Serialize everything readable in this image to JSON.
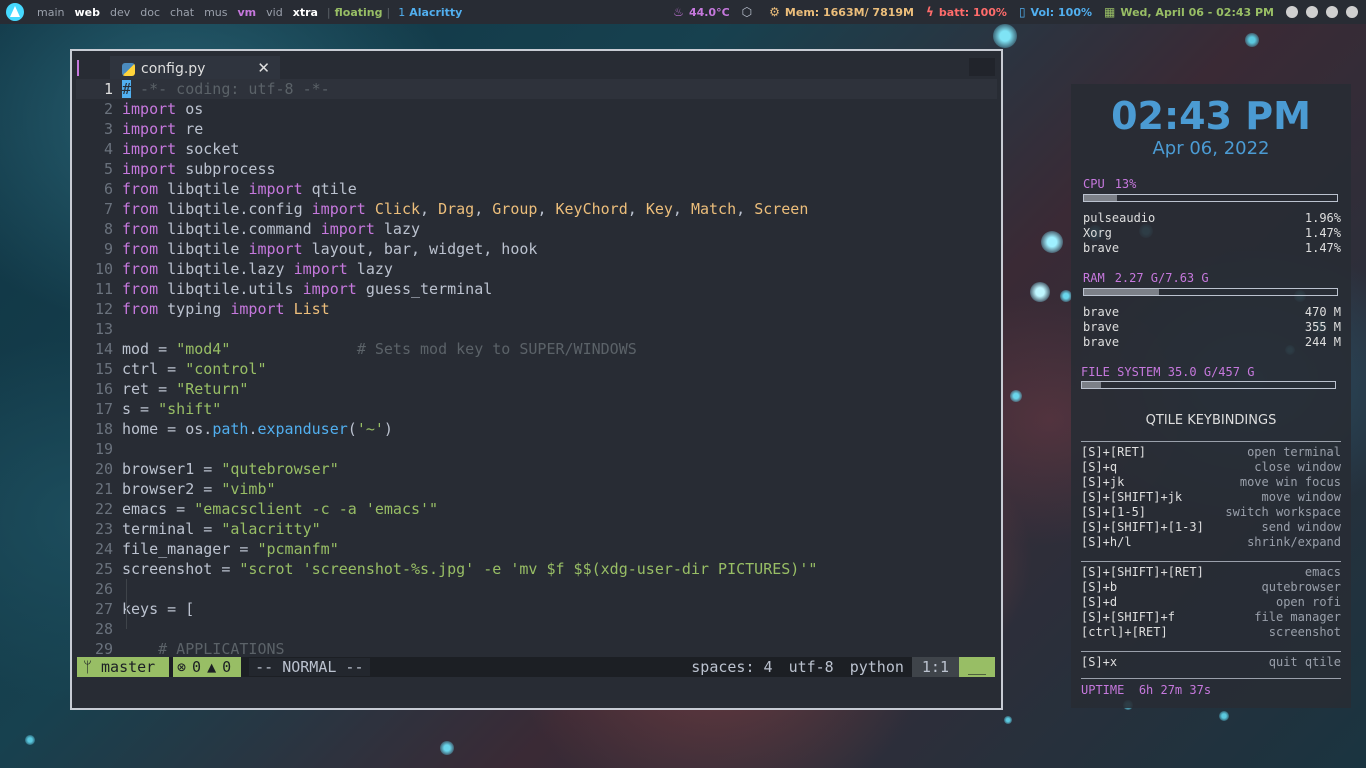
{
  "topbar": {
    "workspaces": [
      {
        "label": "main",
        "state": "normal"
      },
      {
        "label": "web",
        "state": "active"
      },
      {
        "label": "dev",
        "state": "normal"
      },
      {
        "label": "doc",
        "state": "normal"
      },
      {
        "label": "chat",
        "state": "normal"
      },
      {
        "label": "mus",
        "state": "normal"
      },
      {
        "label": "vm",
        "state": "current"
      },
      {
        "label": "vid",
        "state": "normal"
      },
      {
        "label": "xtra",
        "state": "active"
      }
    ],
    "layout": "floating",
    "window_count": "1",
    "window_title": "Alacritty",
    "temp": "44.0°C",
    "mem": "Mem: 1663M/ 7819M",
    "batt": "batt: 100%",
    "vol": "Vol: 100%",
    "date": "Wed, April 06 - 02:43 PM",
    "colors": {
      "accent": "#51afef",
      "purple": "#c678dd",
      "green": "#98be65",
      "yellow": "#ecbe7b",
      "red": "#ff6c6b"
    }
  },
  "editor": {
    "tab_name": "config.py",
    "close_glyph": "✕",
    "lines": [
      [
        {
          "t": "#",
          "c": "cursor"
        },
        {
          "t": " -*- coding: utf-8 -*-",
          "c": "cmt"
        }
      ],
      [
        {
          "t": "import",
          "c": "kw"
        },
        {
          "t": " os",
          "c": ""
        }
      ],
      [
        {
          "t": "import",
          "c": "kw"
        },
        {
          "t": " re",
          "c": ""
        }
      ],
      [
        {
          "t": "import",
          "c": "kw"
        },
        {
          "t": " socket",
          "c": ""
        }
      ],
      [
        {
          "t": "import",
          "c": "kw"
        },
        {
          "t": " subprocess",
          "c": ""
        }
      ],
      [
        {
          "t": "from",
          "c": "kw"
        },
        {
          "t": " libqtile ",
          "c": ""
        },
        {
          "t": "import",
          "c": "kw"
        },
        {
          "t": " qtile",
          "c": ""
        }
      ],
      [
        {
          "t": "from",
          "c": "kw"
        },
        {
          "t": " libqtile.config ",
          "c": ""
        },
        {
          "t": "import",
          "c": "kw"
        },
        {
          "t": " ",
          "c": ""
        },
        {
          "t": "Click",
          "c": "cls"
        },
        {
          "t": ", ",
          "c": ""
        },
        {
          "t": "Drag",
          "c": "cls"
        },
        {
          "t": ", ",
          "c": ""
        },
        {
          "t": "Group",
          "c": "cls"
        },
        {
          "t": ", ",
          "c": ""
        },
        {
          "t": "KeyChord",
          "c": "cls"
        },
        {
          "t": ", ",
          "c": ""
        },
        {
          "t": "Key",
          "c": "cls"
        },
        {
          "t": ", ",
          "c": ""
        },
        {
          "t": "Match",
          "c": "cls"
        },
        {
          "t": ", ",
          "c": ""
        },
        {
          "t": "Screen",
          "c": "cls"
        }
      ],
      [
        {
          "t": "from",
          "c": "kw"
        },
        {
          "t": " libqtile.command ",
          "c": ""
        },
        {
          "t": "import",
          "c": "kw"
        },
        {
          "t": " lazy",
          "c": ""
        }
      ],
      [
        {
          "t": "from",
          "c": "kw"
        },
        {
          "t": " libqtile ",
          "c": ""
        },
        {
          "t": "import",
          "c": "kw"
        },
        {
          "t": " layout, bar, widget, hook",
          "c": ""
        }
      ],
      [
        {
          "t": "from",
          "c": "kw"
        },
        {
          "t": " libqtile.lazy ",
          "c": ""
        },
        {
          "t": "import",
          "c": "kw"
        },
        {
          "t": " lazy",
          "c": ""
        }
      ],
      [
        {
          "t": "from",
          "c": "kw"
        },
        {
          "t": " libqtile.utils ",
          "c": ""
        },
        {
          "t": "import",
          "c": "kw"
        },
        {
          "t": " guess_terminal",
          "c": ""
        }
      ],
      [
        {
          "t": "from",
          "c": "kw"
        },
        {
          "t": " typing ",
          "c": ""
        },
        {
          "t": "import",
          "c": "kw"
        },
        {
          "t": " ",
          "c": ""
        },
        {
          "t": "List",
          "c": "cls"
        }
      ],
      [],
      [
        {
          "t": "mod = ",
          "c": ""
        },
        {
          "t": "\"mod4\"",
          "c": "str"
        },
        {
          "t": "              ",
          "c": ""
        },
        {
          "t": "# Sets mod key to SUPER/WINDOWS",
          "c": "cmt"
        }
      ],
      [
        {
          "t": "ctrl = ",
          "c": ""
        },
        {
          "t": "\"control\"",
          "c": "str"
        }
      ],
      [
        {
          "t": "ret = ",
          "c": ""
        },
        {
          "t": "\"Return\"",
          "c": "str"
        }
      ],
      [
        {
          "t": "s = ",
          "c": ""
        },
        {
          "t": "\"shift\"",
          "c": "str"
        }
      ],
      [
        {
          "t": "home = os.",
          "c": ""
        },
        {
          "t": "path",
          "c": "attr"
        },
        {
          "t": ".",
          "c": ""
        },
        {
          "t": "expanduser",
          "c": "attr"
        },
        {
          "t": "(",
          "c": ""
        },
        {
          "t": "'~'",
          "c": "str"
        },
        {
          "t": ")",
          "c": ""
        }
      ],
      [],
      [
        {
          "t": "browser1 = ",
          "c": ""
        },
        {
          "t": "\"qutebrowser\"",
          "c": "str"
        }
      ],
      [
        {
          "t": "browser2 = ",
          "c": ""
        },
        {
          "t": "\"vimb\"",
          "c": "str"
        }
      ],
      [
        {
          "t": "emacs = ",
          "c": ""
        },
        {
          "t": "\"emacsclient -c -a 'emacs'\"",
          "c": "str"
        }
      ],
      [
        {
          "t": "terminal = ",
          "c": ""
        },
        {
          "t": "\"alacritty\"",
          "c": "str"
        }
      ],
      [
        {
          "t": "file_manager = ",
          "c": ""
        },
        {
          "t": "\"pcmanfm\"",
          "c": "str"
        }
      ],
      [
        {
          "t": "screenshot = ",
          "c": ""
        },
        {
          "t": "\"scrot 'screenshot-%s.jpg' -e 'mv $f $$(xdg-user-dir PICTURES)'\"",
          "c": "str"
        }
      ],
      [],
      [
        {
          "t": "keys = [",
          "c": ""
        }
      ],
      [],
      [
        {
          "t": "    ",
          "c": ""
        },
        {
          "t": "# APPLICATIONS",
          "c": "cmt"
        }
      ]
    ],
    "current_line": 1
  },
  "statusline": {
    "branch": "master",
    "errors": "0",
    "warnings": "0",
    "mode": "-- NORMAL --",
    "spaces": "spaces: 4",
    "encoding": "utf-8",
    "filetype": "python",
    "position": "1:1",
    "end": "__"
  },
  "conky": {
    "time": "02:43 PM",
    "date": "Apr 06, 2022",
    "cpu_label": "CPU",
    "cpu_value": "13%",
    "cpu_fraction": 0.13,
    "cpu_procs": [
      {
        "name": "pulseaudio",
        "value": "1.96%"
      },
      {
        "name": "Xorg",
        "value": "1.47%"
      },
      {
        "name": "brave",
        "value": "1.47%"
      }
    ],
    "ram_label": "RAM",
    "ram_value": "2.27 G/7.63 G",
    "ram_fraction": 0.297,
    "ram_procs": [
      {
        "name": "brave",
        "value": "470 M"
      },
      {
        "name": "brave",
        "value": "355 M"
      },
      {
        "name": "brave",
        "value": "244 M"
      }
    ],
    "fs_label": "FILE SYSTEM",
    "fs_value": "35.0 G/457 G",
    "fs_fraction": 0.077,
    "keybindings_title": "QTILE KEYBINDINGS",
    "keybindings": [
      [
        {
          "key": "[S]+[RET]",
          "action": "open terminal"
        },
        {
          "key": "[S]+q",
          "action": "close window"
        },
        {
          "key": "[S]+jk",
          "action": "move win focus"
        },
        {
          "key": "[S]+[SHIFT]+jk",
          "action": "move window"
        },
        {
          "key": "[S]+[1-5]",
          "action": "switch workspace"
        },
        {
          "key": "[S]+[SHIFT]+[1-3]",
          "action": "send window"
        },
        {
          "key": "[S]+h/l",
          "action": "shrink/expand"
        }
      ],
      [
        {
          "key": "[S]+[SHIFT]+[RET]",
          "action": "emacs"
        },
        {
          "key": "[S]+b",
          "action": "qutebrowser"
        },
        {
          "key": "[S]+d",
          "action": "open rofi"
        },
        {
          "key": "[S]+[SHIFT]+f",
          "action": "file manager"
        },
        {
          "key": "[ctrl]+[RET]",
          "action": "screenshot"
        }
      ],
      [
        {
          "key": "[S]+x",
          "action": "quit qtile"
        }
      ]
    ],
    "uptime_label": "UPTIME",
    "uptime_value": "6h 27m 37s"
  }
}
